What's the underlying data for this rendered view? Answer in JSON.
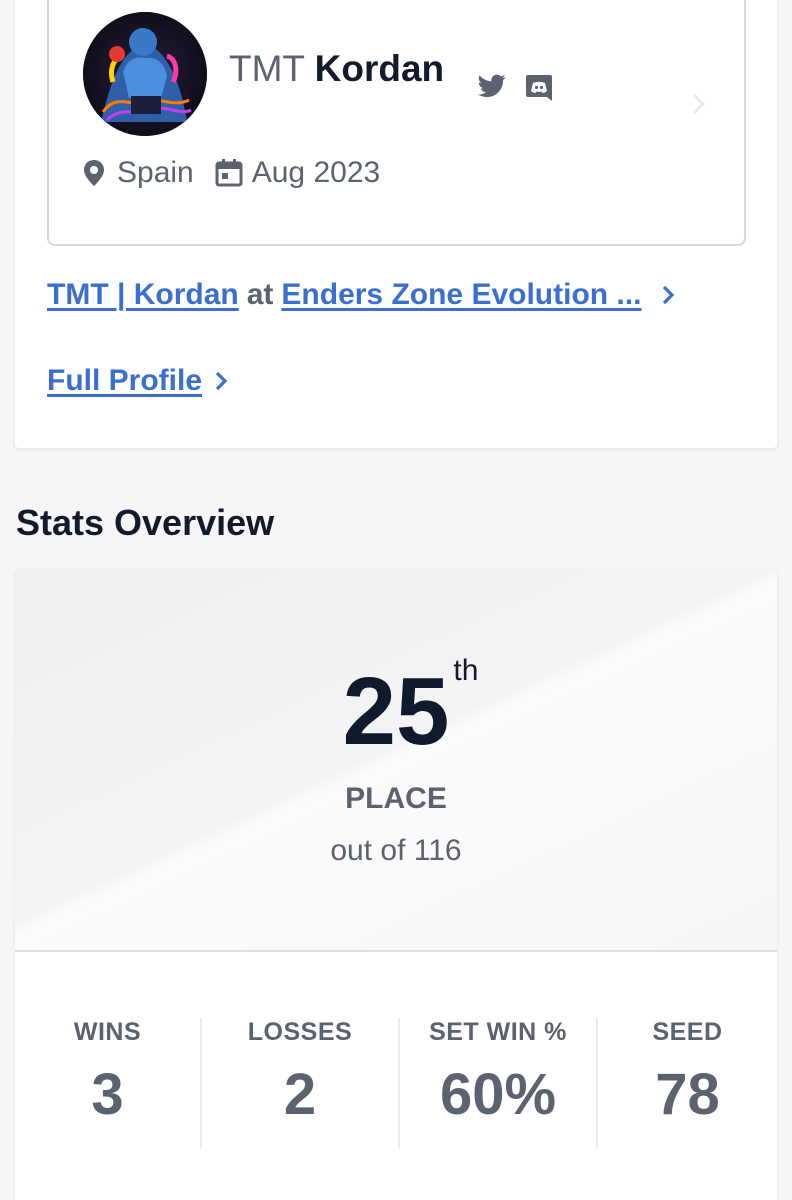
{
  "profile": {
    "prefix": "TMT",
    "gamer_tag": "Kordan",
    "location": "Spain",
    "joined": "Aug 2023",
    "icons": [
      "twitter-icon",
      "discord-icon",
      "location-pin-icon",
      "calendar-icon",
      "chevron-right-icon"
    ]
  },
  "event_link": {
    "player": "TMT | Kordan",
    "connector": "at",
    "event": "Enders Zone Evolution ..."
  },
  "full_profile_label": "Full Profile",
  "stats": {
    "section_title": "Stats Overview",
    "placement": "25",
    "placement_suffix": "th",
    "place_label": "PLACE",
    "out_of": "out of 116",
    "items": [
      {
        "label": "WINS",
        "value": "3"
      },
      {
        "label": "LOSSES",
        "value": "2"
      },
      {
        "label": "SET WIN %",
        "value": "60%"
      },
      {
        "label": "SEED",
        "value": "78"
      }
    ]
  },
  "colors": {
    "link": "#3a6fd0",
    "text_dark": "#121b2b",
    "text_muted": "#5c6370",
    "border": "#d8dadf"
  }
}
